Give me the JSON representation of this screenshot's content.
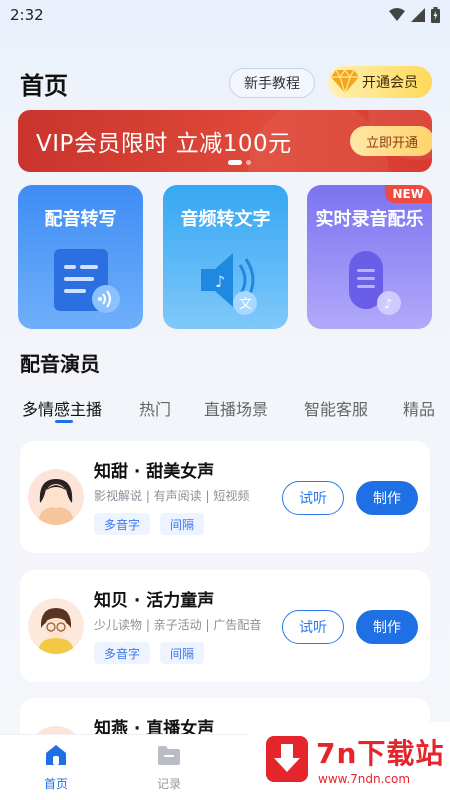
{
  "status_bar": {
    "time": "2:32"
  },
  "header": {
    "title": "首页",
    "tutorial_label": "新手教程",
    "vip_label": "开通会员"
  },
  "banner": {
    "text": "VIP会员限时 立减100元",
    "button_label": "立即开通"
  },
  "features": [
    {
      "label": "配音转写"
    },
    {
      "label": "音频转文字"
    },
    {
      "label": "实时录音配乐",
      "badge": "NEW"
    }
  ],
  "section": {
    "title": "配音演员"
  },
  "tabs": [
    "多情感主播",
    "热门",
    "直播场景",
    "智能客服",
    "精品"
  ],
  "voices": [
    {
      "name": "知甜 · 甜美女声",
      "desc": "影视解说 | 有声阅读 | 短视频",
      "tags": [
        "多音字",
        "间隔"
      ],
      "listen": "试听",
      "make": "制作"
    },
    {
      "name": "知贝 · 活力童声",
      "desc": "少儿读物 | 亲子活动 | 广告配音",
      "tags": [
        "多音字",
        "间隔"
      ],
      "listen": "试听",
      "make": "制作"
    },
    {
      "name": "知燕 · 直播女声"
    }
  ],
  "bottom_nav": {
    "home": "首页",
    "records": "记录"
  },
  "watermark": {
    "title": "7n下载站",
    "url": "www.7ndn.com"
  },
  "colors": {
    "accent": "#1f6fe5",
    "banner": "#d83b30",
    "vip_gold": "#ffd95a"
  }
}
